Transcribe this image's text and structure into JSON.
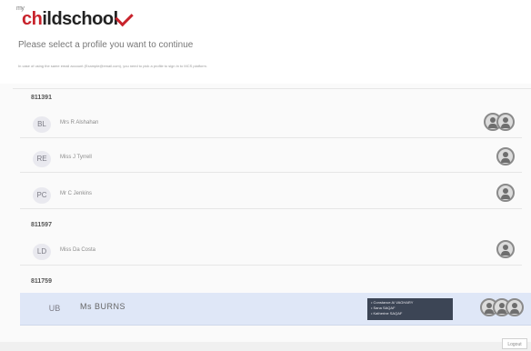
{
  "header": {
    "logo_prefix": "my",
    "logo_main": "childschool",
    "prompt": "Please select a profile you want to continue",
    "notice": "In case of using the same email account (Example@email.com), you need to pick a profile to sign in to MCS platform."
  },
  "groups": [
    {
      "id": "811391",
      "profiles": [
        {
          "initials": "BL",
          "name": "Mrs R Alshahan",
          "icons": 2
        },
        {
          "initials": "RE",
          "name": "Miss J Tyrrell",
          "icons": 1
        },
        {
          "initials": "PC",
          "name": "Mr C Jenkins",
          "icons": 1
        }
      ]
    },
    {
      "id": "811597",
      "profiles": [
        {
          "initials": "LD",
          "name": "Miss Da Costa",
          "icons": 1
        }
      ]
    },
    {
      "id": "811759",
      "profiles": [
        {
          "initials": "UB",
          "name": "Ms BURNS",
          "icons": 3,
          "selected": true
        }
      ]
    }
  ],
  "tooltip": [
    "Constance Al VAGHARY",
    "Sana SAQAF",
    "Katherine SAQAF"
  ],
  "logout_label": "Logout"
}
